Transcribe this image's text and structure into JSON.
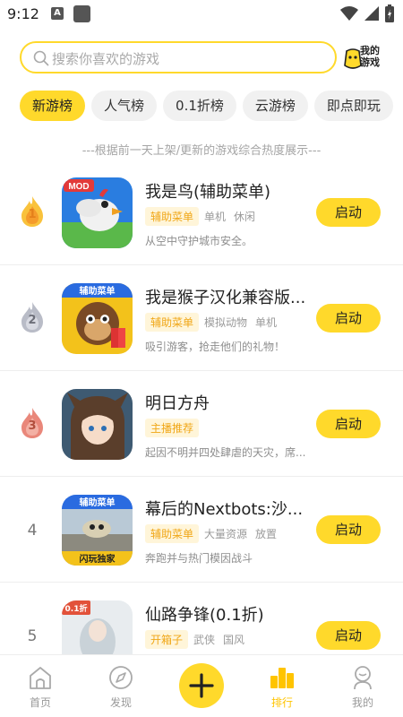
{
  "status": {
    "time": "9:12",
    "notif_letter": "A"
  },
  "search": {
    "placeholder": "搜索你喜欢的游戏",
    "logo_text": "我的\n游戏"
  },
  "tabs": [
    {
      "label": "新游榜",
      "active": true
    },
    {
      "label": "人气榜",
      "active": false
    },
    {
      "label": "0.1折榜",
      "active": false
    },
    {
      "label": "云游榜",
      "active": false
    },
    {
      "label": "即点即玩",
      "active": false
    }
  ],
  "subtitle": "---根据前一天上架/更新的游戏综合热度展示---",
  "games": [
    {
      "rank": "1",
      "title": "我是鸟(辅助菜单)",
      "highlight_tag": "辅助菜单",
      "tags": [
        "单机",
        "休闲"
      ],
      "desc": "从空中守护城市安全。",
      "button": "启动",
      "badge": "MOD"
    },
    {
      "rank": "2",
      "title": "我是猴子汉化兼容版...",
      "highlight_tag": "辅助菜单",
      "tags": [
        "模拟动物",
        "单机"
      ],
      "desc": "吸引游客，抢走他们的礼物！",
      "button": "启动",
      "badge": "辅助菜单"
    },
    {
      "rank": "3",
      "title": "明日方舟",
      "highlight_tag": "主播推荐",
      "tags": [],
      "desc": "起因不明并四处肆虐的天灾，席...",
      "button": "启动",
      "badge": ""
    },
    {
      "rank": "4",
      "title": "幕后的Nextbots:沙...",
      "highlight_tag": "辅助菜单",
      "tags": [
        "大量资源",
        "放置"
      ],
      "desc": "奔跑并与热门模因战斗",
      "button": "启动",
      "badge": "辅助菜单",
      "badge2": "闪玩独家"
    },
    {
      "rank": "5",
      "title": "仙路争锋(0.1折)",
      "highlight_tag": "开箱子",
      "tags": [
        "武侠",
        "国风"
      ],
      "desc": "",
      "button": "启动",
      "badge": "0.1折"
    }
  ],
  "nav": [
    {
      "label": "首页",
      "active": false
    },
    {
      "label": "发现",
      "active": false
    },
    {
      "label": "排行",
      "active": true
    },
    {
      "label": "我的",
      "active": false
    }
  ],
  "colors": {
    "accent": "#ffd92b",
    "tag_text": "#f0a718",
    "tag_bg": "#fff5d9"
  }
}
